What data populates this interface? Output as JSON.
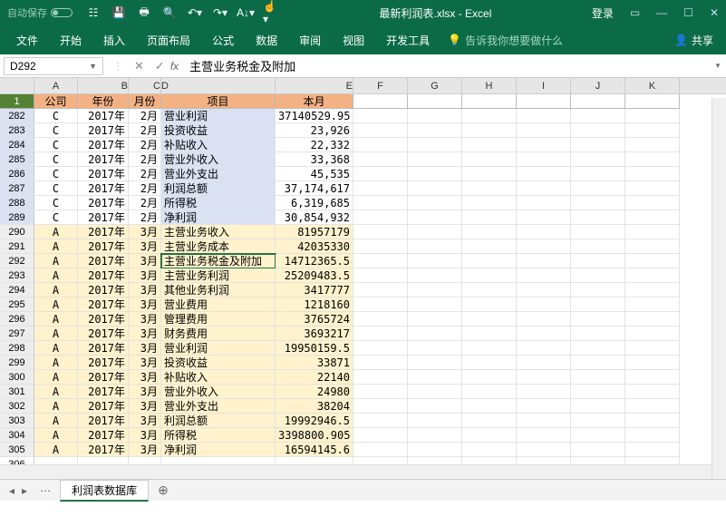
{
  "titlebar": {
    "autosave": "自动保存",
    "doc": "最新利润表.xlsx - Excel",
    "login": "登录"
  },
  "ribbon": {
    "tabs": [
      "文件",
      "开始",
      "插入",
      "页面布局",
      "公式",
      "数据",
      "审阅",
      "视图",
      "开发工具"
    ],
    "tellme": "告诉我你想要做什么",
    "share": "共享"
  },
  "namebox": "D292",
  "formula": "主营业务税金及附加",
  "col_letters": [
    "A",
    "B",
    "C",
    "D",
    "E",
    "F",
    "G",
    "H",
    "I",
    "J",
    "K"
  ],
  "headers": [
    "公司",
    "年份",
    "月份",
    "项目",
    "本月"
  ],
  "active_row": 292,
  "rows": [
    {
      "n": 282,
      "cls": "blue",
      "c": [
        "C",
        "2017年",
        "2月",
        "营业利润",
        "37140529.95"
      ]
    },
    {
      "n": 283,
      "cls": "blue",
      "c": [
        "C",
        "2017年",
        "2月",
        "投资收益",
        "23,926"
      ]
    },
    {
      "n": 284,
      "cls": "blue",
      "c": [
        "C",
        "2017年",
        "2月",
        "补贴收入",
        "22,332"
      ]
    },
    {
      "n": 285,
      "cls": "blue",
      "c": [
        "C",
        "2017年",
        "2月",
        "营业外收入",
        "33,368"
      ]
    },
    {
      "n": 286,
      "cls": "blue",
      "c": [
        "C",
        "2017年",
        "2月",
        "营业外支出",
        "45,535"
      ]
    },
    {
      "n": 287,
      "cls": "blue",
      "c": [
        "C",
        "2017年",
        "2月",
        "利润总额",
        "37,174,617"
      ]
    },
    {
      "n": 288,
      "cls": "blue",
      "c": [
        "C",
        "2017年",
        "2月",
        "所得税",
        "6,319,685"
      ]
    },
    {
      "n": 289,
      "cls": "blue",
      "c": [
        "C",
        "2017年",
        "2月",
        "净利润",
        "30,854,932"
      ]
    },
    {
      "n": 290,
      "cls": "pale",
      "c": [
        "A",
        "2017年",
        "3月",
        "主营业务收入",
        "81957179"
      ]
    },
    {
      "n": 291,
      "cls": "pale",
      "c": [
        "A",
        "2017年",
        "3月",
        "主营业务成本",
        "42035330"
      ]
    },
    {
      "n": 292,
      "cls": "pale",
      "c": [
        "A",
        "2017年",
        "3月",
        "主营业务税金及附加",
        "14712365.5"
      ]
    },
    {
      "n": 293,
      "cls": "pale",
      "c": [
        "A",
        "2017年",
        "3月",
        "主营业务利润",
        "25209483.5"
      ]
    },
    {
      "n": 294,
      "cls": "pale",
      "c": [
        "A",
        "2017年",
        "3月",
        "其他业务利润",
        "3417777"
      ]
    },
    {
      "n": 295,
      "cls": "pale",
      "c": [
        "A",
        "2017年",
        "3月",
        "营业费用",
        "1218160"
      ]
    },
    {
      "n": 296,
      "cls": "pale",
      "c": [
        "A",
        "2017年",
        "3月",
        "管理费用",
        "3765724"
      ]
    },
    {
      "n": 297,
      "cls": "pale",
      "c": [
        "A",
        "2017年",
        "3月",
        "财务费用",
        "3693217"
      ]
    },
    {
      "n": 298,
      "cls": "pale",
      "c": [
        "A",
        "2017年",
        "3月",
        "营业利润",
        "19950159.5"
      ]
    },
    {
      "n": 299,
      "cls": "pale",
      "c": [
        "A",
        "2017年",
        "3月",
        "投资收益",
        "33871"
      ]
    },
    {
      "n": 300,
      "cls": "pale",
      "c": [
        "A",
        "2017年",
        "3月",
        "补贴收入",
        "22140"
      ]
    },
    {
      "n": 301,
      "cls": "pale",
      "c": [
        "A",
        "2017年",
        "3月",
        "营业外收入",
        "24980"
      ]
    },
    {
      "n": 302,
      "cls": "pale",
      "c": [
        "A",
        "2017年",
        "3月",
        "营业外支出",
        "38204"
      ]
    },
    {
      "n": 303,
      "cls": "pale",
      "c": [
        "A",
        "2017年",
        "3月",
        "利润总额",
        "19992946.5"
      ]
    },
    {
      "n": 304,
      "cls": "pale",
      "c": [
        "A",
        "2017年",
        "3月",
        "所得税",
        "3398800.905"
      ]
    },
    {
      "n": 305,
      "cls": "pale",
      "c": [
        "A",
        "2017年",
        "3月",
        "净利润",
        "16594145.6"
      ]
    },
    {
      "n": 306,
      "cls": "white",
      "c": [
        "",
        "",
        "",
        "",
        ""
      ]
    }
  ],
  "sheet_tab": "利润表数据库"
}
